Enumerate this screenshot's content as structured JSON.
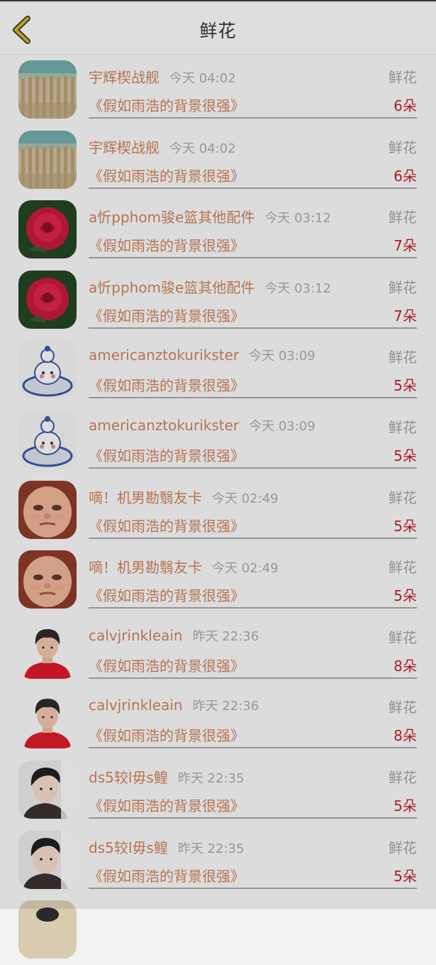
{
  "header": {
    "title": "鲜花"
  },
  "rows": [
    {
      "name": "宇辉楔战舰",
      "time": "今天 04:02",
      "type": "鲜花",
      "book": "《假如雨浩的背景很强》",
      "count": "6朵",
      "avatar": "fence-photo"
    },
    {
      "name": "宇辉楔战舰",
      "time": "今天 04:02",
      "type": "鲜花",
      "book": "《假如雨浩的背景很强》",
      "count": "6朵",
      "avatar": "fence-photo"
    },
    {
      "name": "a忻pphom骏e篮其他配件",
      "time": "今天 03:12",
      "type": "鲜花",
      "book": "《假如雨浩的背景很强》",
      "count": "7朵",
      "avatar": "rose-photo"
    },
    {
      "name": "a忻pphom骏e篮其他配件",
      "time": "今天 03:12",
      "type": "鲜花",
      "book": "《假如雨浩的背景很强》",
      "count": "7朵",
      "avatar": "rose-photo"
    },
    {
      "name": "americanztokurikster",
      "time": "今天 03:09",
      "type": "鲜花",
      "book": "《假如雨浩的背景很强》",
      "count": "5朵",
      "avatar": "porcelain-doll"
    },
    {
      "name": "americanztokurikster",
      "time": "今天 03:09",
      "type": "鲜花",
      "book": "《假如雨浩的背景很强》",
      "count": "5朵",
      "avatar": "porcelain-doll"
    },
    {
      "name": "嘀！机男勘翳友卡",
      "time": "今天 02:49",
      "type": "鲜花",
      "book": "《假如雨浩的背景很强》",
      "count": "5朵",
      "avatar": "baby-face"
    },
    {
      "name": "嘀！机男勘翳友卡",
      "time": "今天 02:49",
      "type": "鲜花",
      "book": "《假如雨浩的背景很强》",
      "count": "5朵",
      "avatar": "baby-face"
    },
    {
      "name": "calvjrinkleain",
      "time": "昨天 22:36",
      "type": "鲜花",
      "book": "《假如雨浩的背景很强》",
      "count": "8朵",
      "avatar": "boy-red-shirt"
    },
    {
      "name": "calvjrinkleain",
      "time": "昨天 22:36",
      "type": "鲜花",
      "book": "《假如雨浩的背景很强》",
      "count": "8朵",
      "avatar": "boy-red-shirt"
    },
    {
      "name": "ds5较l毋s鳇",
      "time": "昨天 22:35",
      "type": "鲜花",
      "book": "《假如雨浩的背景很强》",
      "count": "5朵",
      "avatar": "man-portrait"
    },
    {
      "name": "ds5较l毋s鳇",
      "time": "昨天 22:35",
      "type": "鲜花",
      "book": "《假如雨浩的背景很强》",
      "count": "5朵",
      "avatar": "man-portrait"
    }
  ],
  "colors": {
    "name": "#c9805c",
    "count": "#c0202a",
    "back_icon": "#d4b020"
  }
}
